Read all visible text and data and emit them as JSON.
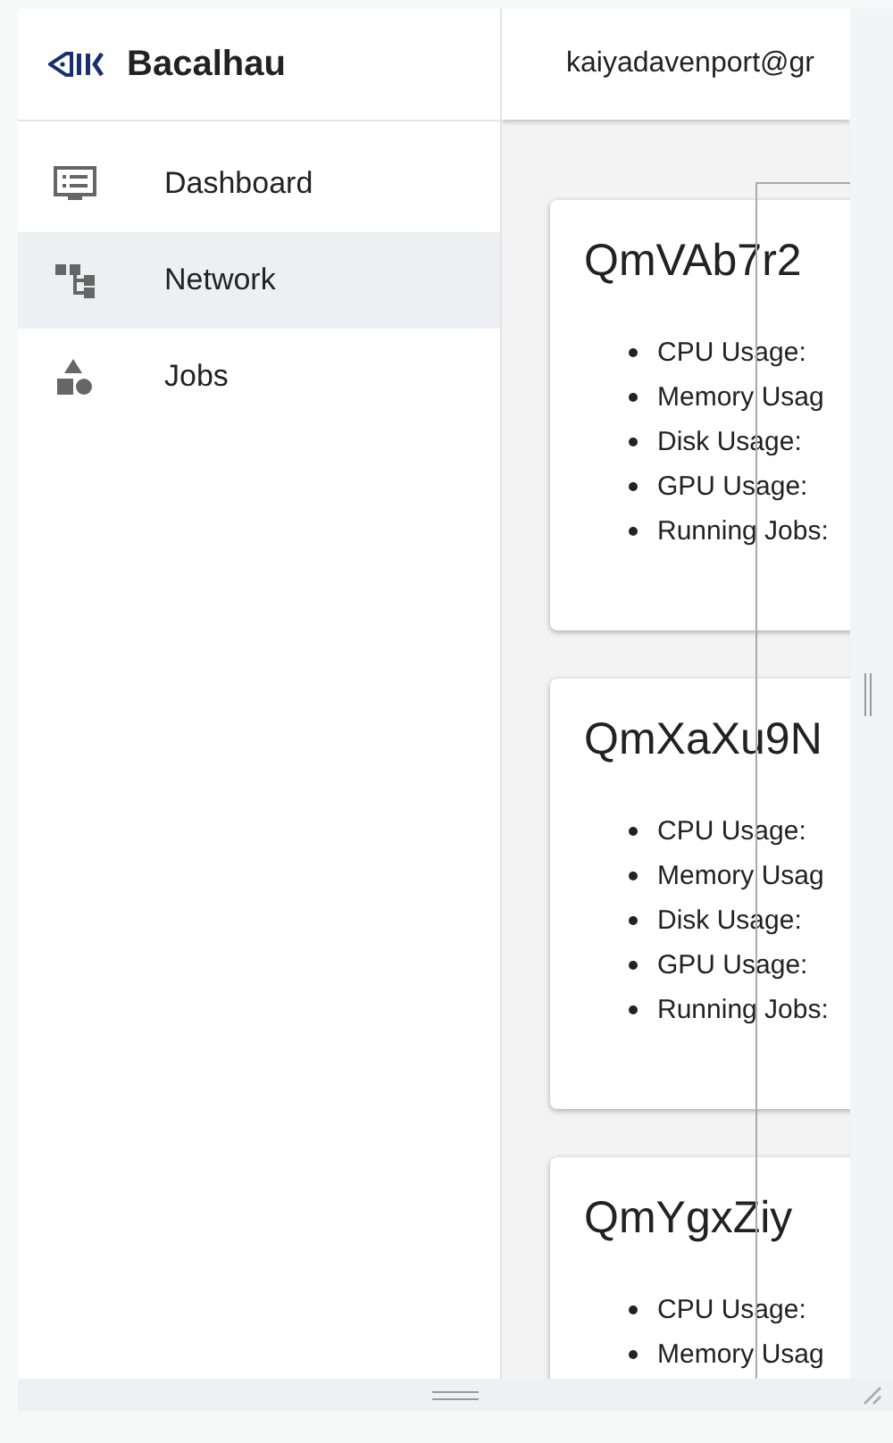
{
  "brand": {
    "name": "Bacalhau"
  },
  "header": {
    "user": "kaiyadavenport@gr"
  },
  "sidebar": {
    "items": [
      {
        "kind": "dashboard",
        "label": "Dashboard",
        "selected": false
      },
      {
        "kind": "network",
        "label": "Network",
        "selected": true
      },
      {
        "kind": "jobs",
        "label": "Jobs",
        "selected": false
      }
    ]
  },
  "nodes": [
    {
      "id": "QmVAb7r2",
      "stats": [
        "CPU Usage:",
        "Memory Usag",
        "Disk Usage:",
        "GPU Usage:",
        "Running Jobs:"
      ]
    },
    {
      "id": "QmXaXu9N",
      "stats": [
        "CPU Usage:",
        "Memory Usag",
        "Disk Usage:",
        "GPU Usage:",
        "Running Jobs:"
      ]
    },
    {
      "id": "QmYgxZiy",
      "stats": [
        "CPU Usage:",
        "Memory Usag"
      ]
    }
  ]
}
